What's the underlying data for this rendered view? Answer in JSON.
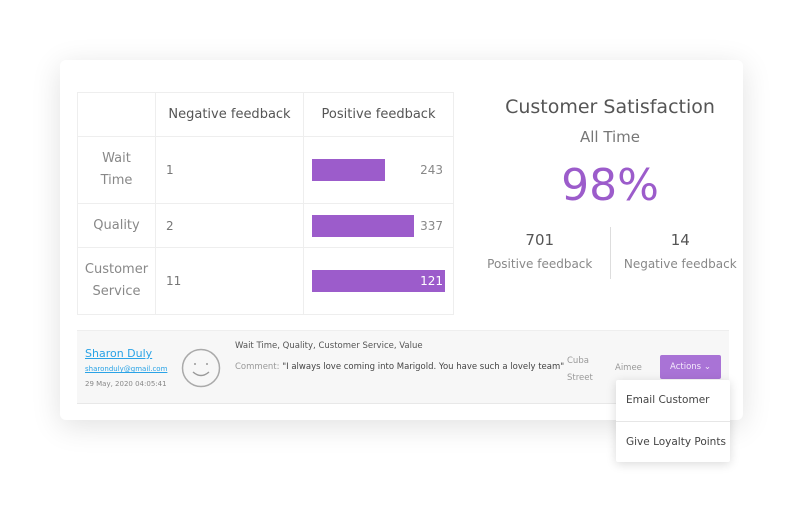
{
  "table": {
    "headers": [
      "",
      "Negative feedback",
      "Positive feedback"
    ],
    "rows": [
      {
        "label_lines": [
          "Wait",
          "Time"
        ],
        "negative": "1",
        "positive": "243",
        "bar_fill_pct": 55
      },
      {
        "label_lines": [
          "Quality"
        ],
        "negative": "2",
        "positive": "337",
        "bar_fill_pct": 77
      },
      {
        "label_lines": [
          "Customer",
          "Service"
        ],
        "negative": "11",
        "positive": "121",
        "bar_fill_pct": 100
      }
    ]
  },
  "satisfaction": {
    "title": "Customer Satisfaction",
    "period": "All Time",
    "percent": "98%",
    "positive_count": "701",
    "positive_label": "Positive feedback",
    "negative_count": "14",
    "negative_label": "Negative feedback"
  },
  "feedback": {
    "name": "Sharon Duly",
    "email": "sharonduly@gmail.com",
    "date": "29 May, 2020 04:05:41",
    "face_icon": "smiley-face-icon",
    "categories": "Wait Time, Quality, Customer Service, Value",
    "comment_label": "Comment:",
    "comment": "\"I always love coming into Marigold. You have such a lovely team\"",
    "location_lines": [
      "Cuba",
      "Street"
    ],
    "staff": "Aimee",
    "actions_label": "Actions"
  },
  "menu": {
    "items": [
      "Email Customer",
      "Give Loyalty Points"
    ]
  },
  "colors": {
    "accent": "#9c5ccb",
    "link": "#2aa3e6"
  }
}
